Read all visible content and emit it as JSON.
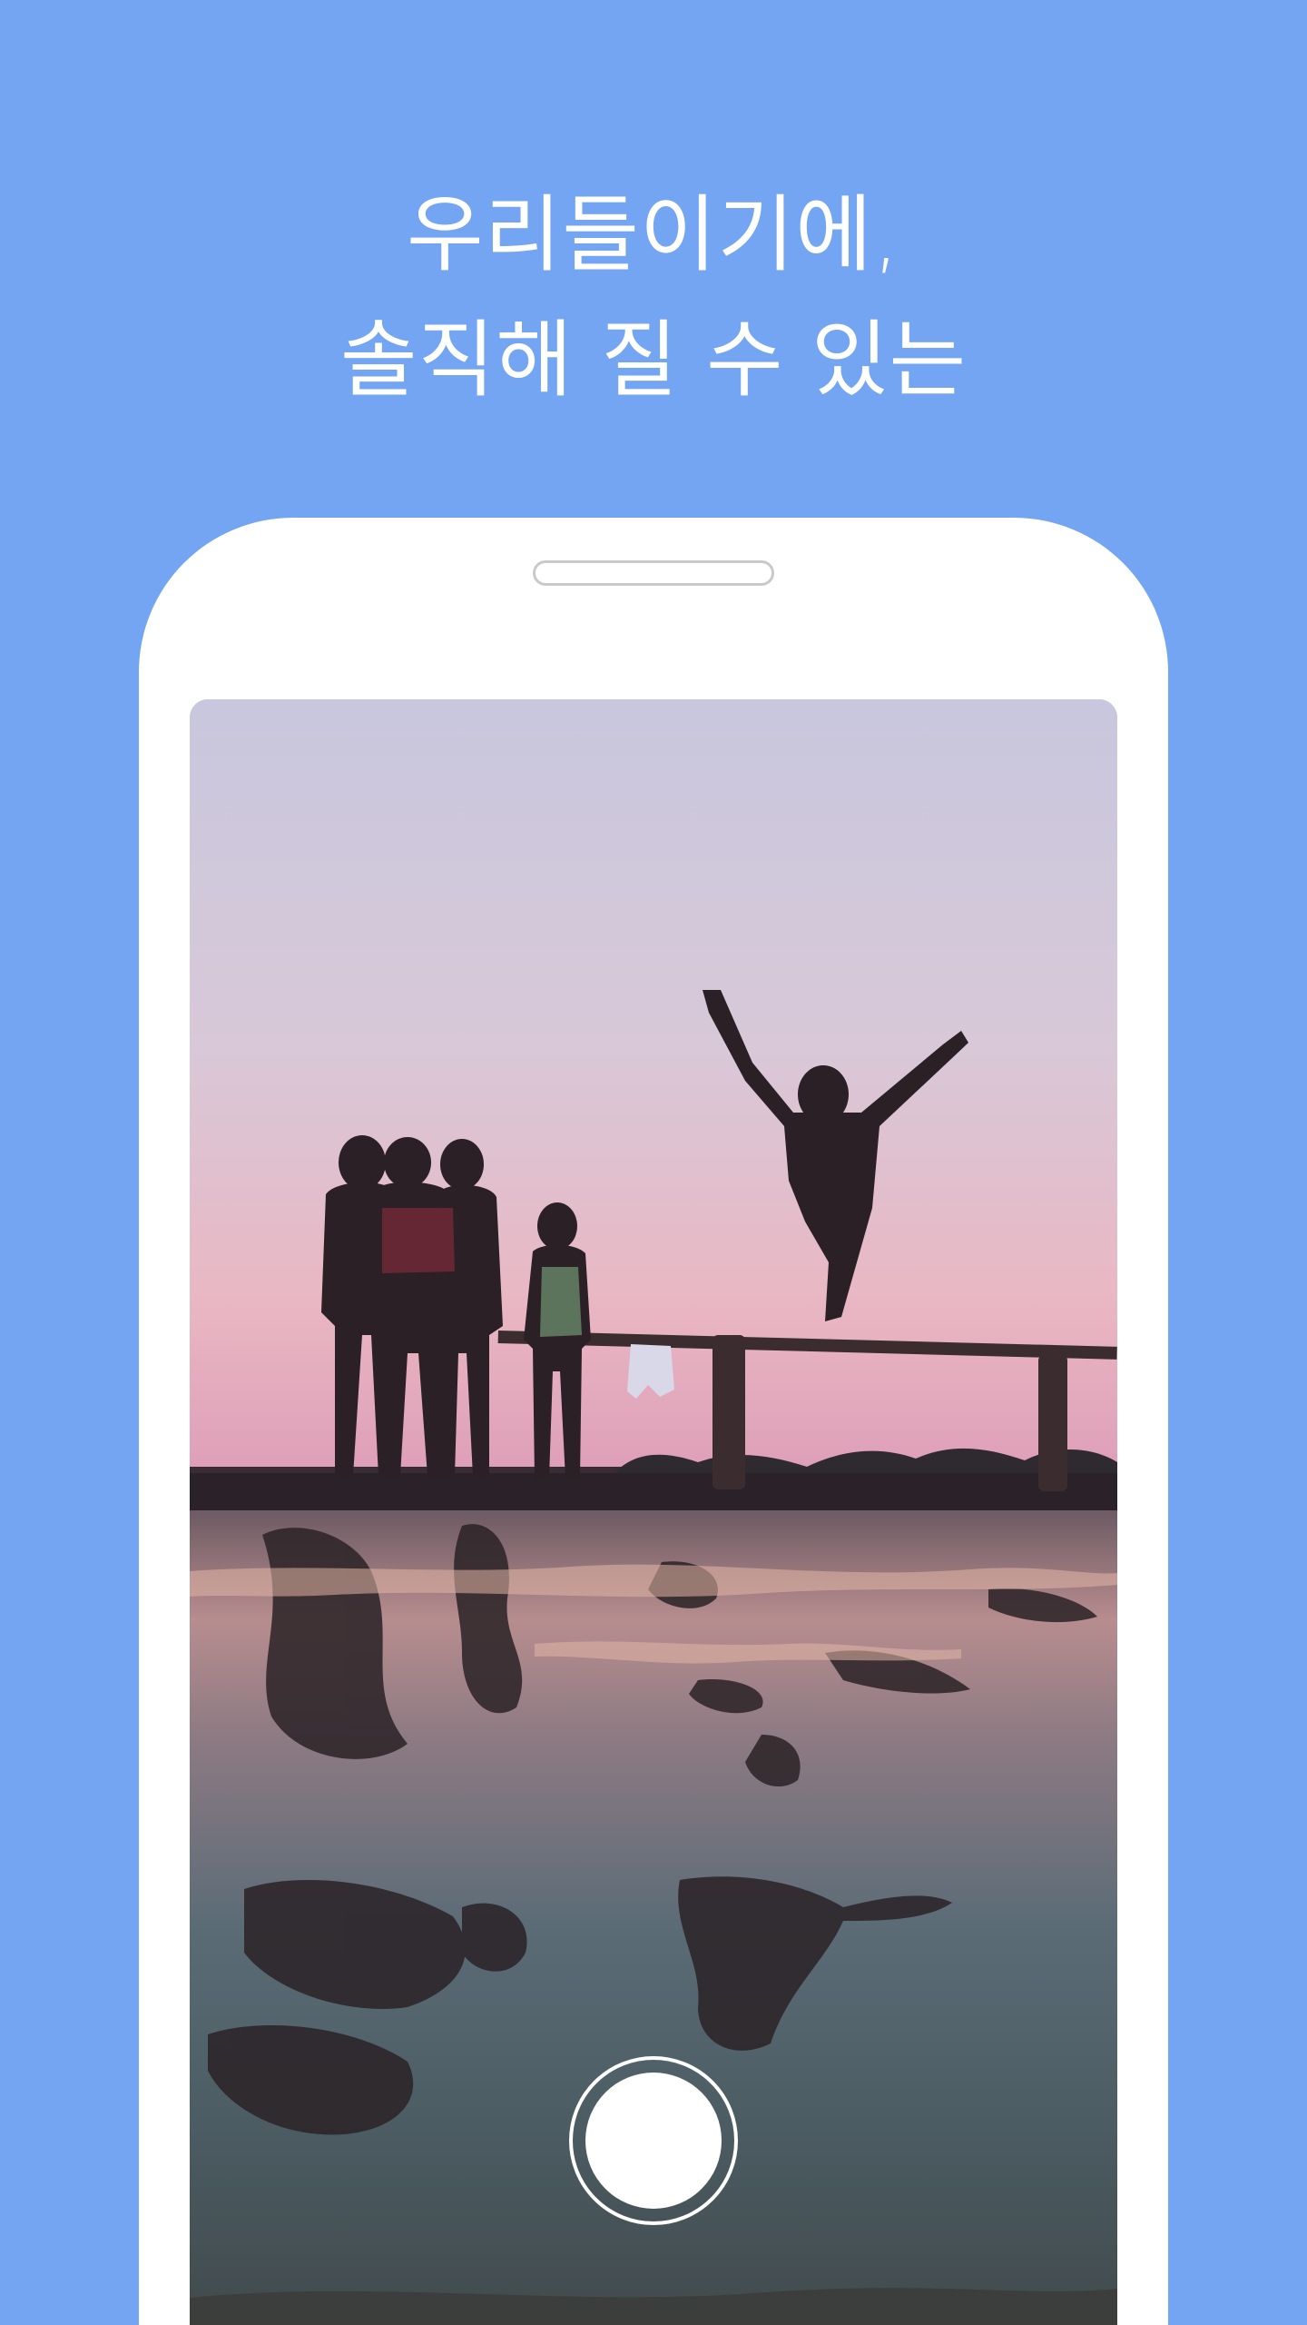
{
  "headline": {
    "line1": "우리들이기에,",
    "line2": "솔직해 질 수 있는"
  },
  "colors": {
    "background": "#74a5f2",
    "phone_body": "#ffffff",
    "text": "#ffffff"
  },
  "camera": {
    "photo_description_icon": "photo-preview-icon",
    "shutter_icon": "shutter-icon"
  }
}
